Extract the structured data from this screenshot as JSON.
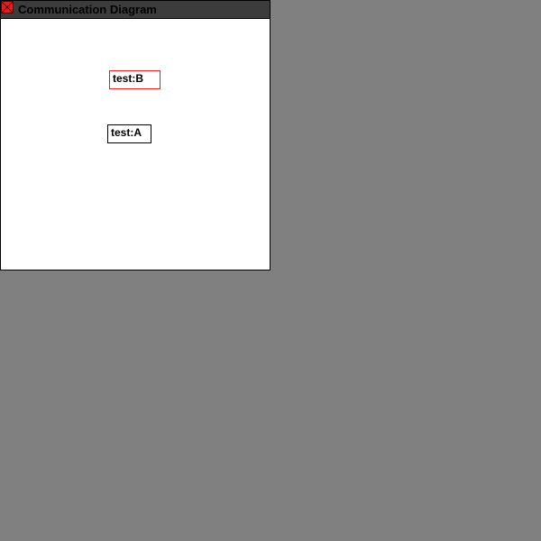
{
  "window": {
    "title": "Communication Diagram",
    "close_icon": "close-icon"
  },
  "diagram": {
    "objects": [
      {
        "label": "test:B",
        "selected": true,
        "border_color": "#e02020"
      },
      {
        "label": "test:A",
        "selected": false,
        "border_color": "#000000"
      }
    ]
  },
  "colors": {
    "desktop": "#808080",
    "titlebar": "#3c3c3c",
    "close_button": "#e02020",
    "selection": "#e02020"
  }
}
